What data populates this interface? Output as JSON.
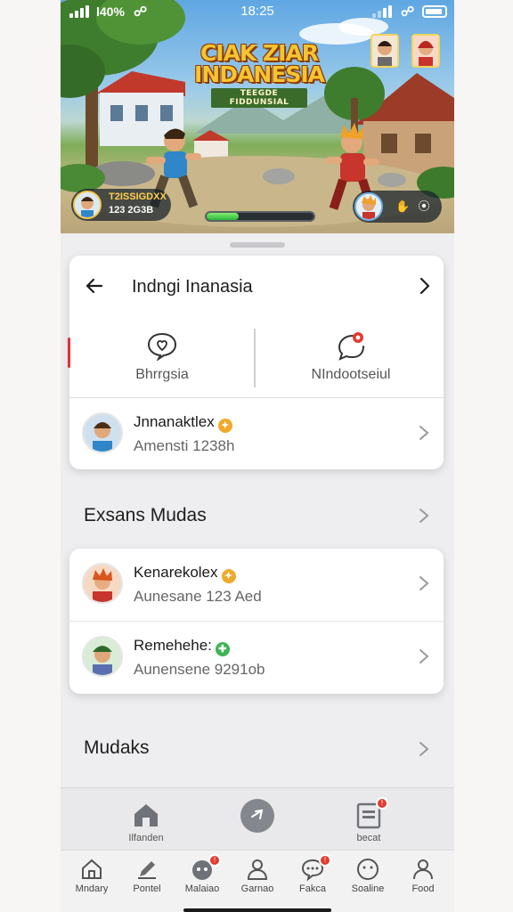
{
  "status_bar": {
    "carrier": "l40%",
    "time": "18:25"
  },
  "game": {
    "logo_line1": "CIAK ZIAR",
    "logo_line2": "INDANESIA",
    "logo_subtitle": "TEEGDE FIDDUNSIAL",
    "player_name": "T2ISSIGDXX",
    "player_score": "123 2G3B",
    "progress_percent": 30
  },
  "card1": {
    "title": "Indngi Inanasia",
    "tabs": [
      {
        "label": "Bhrrgsia",
        "icon": "heart-chat-icon"
      },
      {
        "label": "NIndootseiul",
        "icon": "chat-bubble-icon"
      }
    ],
    "row": {
      "name": "Jnnanaktlex",
      "subtitle": "Amensti 1238h"
    }
  },
  "section1": {
    "title": "Exsans Mudas"
  },
  "card2": {
    "rows": [
      {
        "name": "Kenarekolex",
        "subtitle": "Aunesane 123 Aed"
      },
      {
        "name": "Remehehe:",
        "subtitle": "Aunensene 9291ob"
      }
    ]
  },
  "section2": {
    "title": "Mudaks"
  },
  "nav_top": {
    "items": [
      {
        "label": "Ilfanden",
        "icon": "home-icon"
      },
      {
        "label": "",
        "icon": "compose-icon"
      },
      {
        "label": "becat",
        "icon": "document-icon"
      }
    ]
  },
  "nav_bottom": {
    "items": [
      {
        "label": "Mndary",
        "icon": "house-icon"
      },
      {
        "label": "Pontel",
        "icon": "edit-icon"
      },
      {
        "label": "Malaiao",
        "icon": "game-icon"
      },
      {
        "label": "Garnao",
        "icon": "user-icon"
      },
      {
        "label": "Fakca",
        "icon": "chat-icon"
      },
      {
        "label": "Soaline",
        "icon": "smile-icon"
      },
      {
        "label": "Food",
        "icon": "profile-icon"
      }
    ]
  },
  "colors": {
    "accent_red": "#e23b32",
    "gold_badge": "#f0a92a",
    "green_badge": "#3cb455"
  }
}
